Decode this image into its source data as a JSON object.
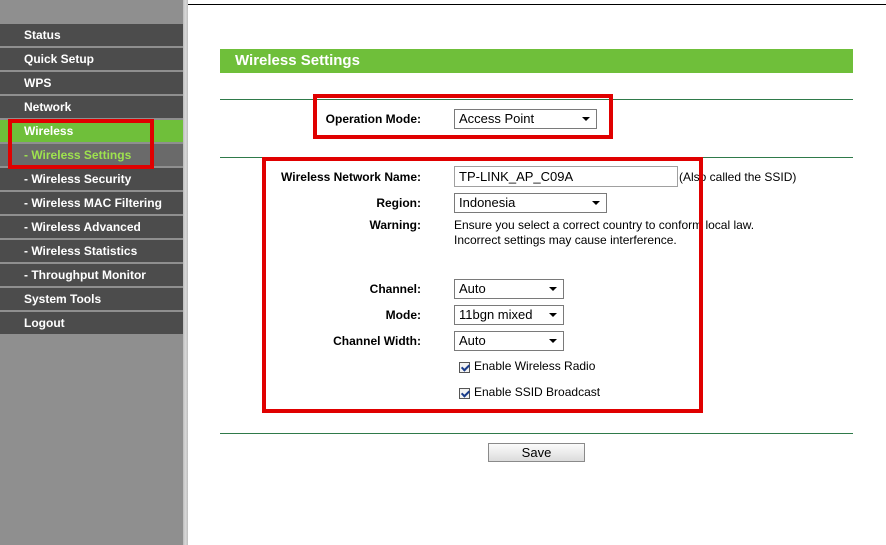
{
  "sidebar": {
    "items": [
      {
        "label": "Status"
      },
      {
        "label": "Quick Setup"
      },
      {
        "label": "WPS"
      },
      {
        "label": "Network"
      },
      {
        "label": "Wireless"
      },
      {
        "label": "- Wireless Settings"
      },
      {
        "label": "- Wireless Security"
      },
      {
        "label": "- Wireless MAC Filtering"
      },
      {
        "label": "- Wireless Advanced"
      },
      {
        "label": "- Wireless Statistics"
      },
      {
        "label": "- Throughput Monitor"
      },
      {
        "label": "System Tools"
      },
      {
        "label": "Logout"
      }
    ]
  },
  "main": {
    "title": "Wireless Settings",
    "operation_mode": {
      "label": "Operation Mode:",
      "value": "Access Point"
    },
    "ssid": {
      "label": "Wireless Network Name:",
      "value": "TP-LINK_AP_C09A",
      "note": "(Also called the SSID)"
    },
    "region": {
      "label": "Region:",
      "value": "Indonesia"
    },
    "warning": {
      "label": "Warning:",
      "line1": "Ensure you select a correct country to conform local law.",
      "line2": "Incorrect settings may cause interference."
    },
    "channel": {
      "label": "Channel:",
      "value": "Auto"
    },
    "mode": {
      "label": "Mode:",
      "value": "11bgn mixed"
    },
    "channel_width": {
      "label": "Channel Width:",
      "value": "Auto"
    },
    "enable_radio": {
      "label": "Enable Wireless Radio",
      "checked": true
    },
    "enable_ssid_broadcast": {
      "label": "Enable SSID Broadcast",
      "checked": true
    },
    "save_label": "Save"
  },
  "colors": {
    "accent_green": "#6fbf3a",
    "sidebar_bg": "#4c4c4c",
    "highlight_red": "#e00000"
  }
}
